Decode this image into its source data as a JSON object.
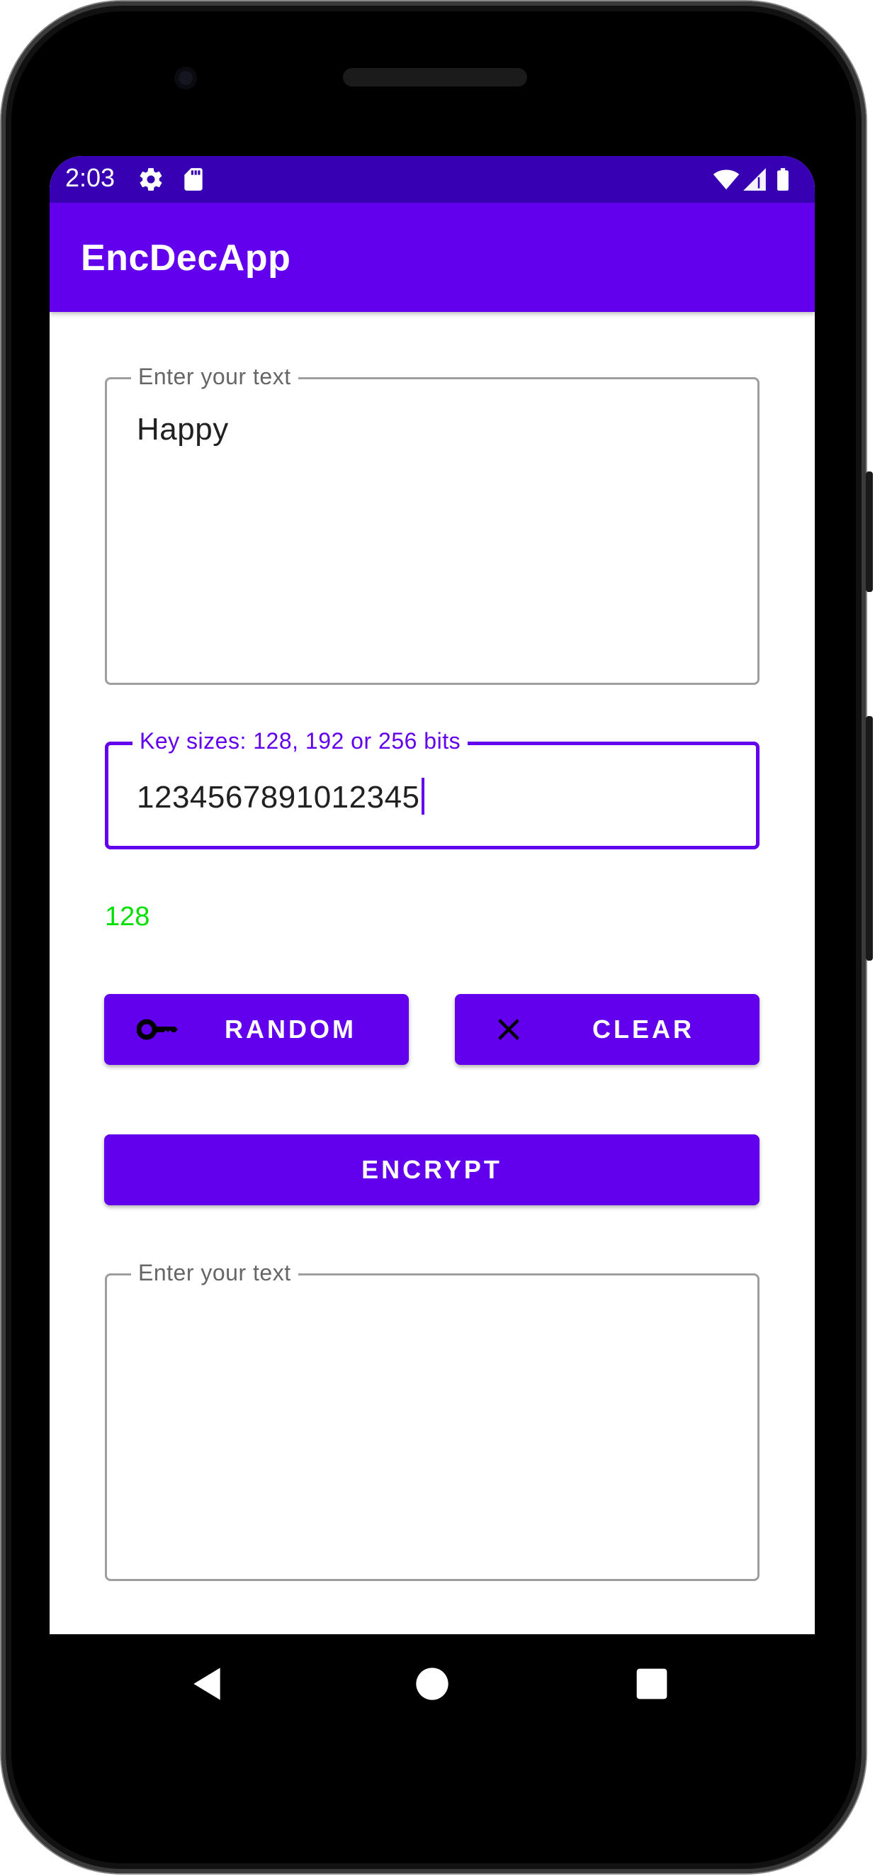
{
  "status_bar": {
    "time": "2:03",
    "icons": [
      "settings-icon",
      "sd-card-icon",
      "wifi-icon",
      "cellular-signal-icon",
      "battery-icon"
    ]
  },
  "app_bar": {
    "title": "EncDecApp"
  },
  "input_text": {
    "label": "Enter your text",
    "value": "Happy"
  },
  "key_field": {
    "label": "Key sizes: 128, 192 or 256 bits",
    "value": "1234567891012345"
  },
  "key_size_indicator": {
    "value": "128",
    "color": "#00e000"
  },
  "buttons": {
    "random": {
      "label": "RANDOM",
      "icon": "key-icon"
    },
    "clear": {
      "label": "CLEAR",
      "icon": "close-icon"
    },
    "encrypt": {
      "label": "ENCRYPT"
    }
  },
  "output_text": {
    "label": "Enter your text",
    "value": ""
  },
  "nav_bar": {
    "icons": [
      "back-icon",
      "home-icon",
      "recents-icon"
    ]
  },
  "colors": {
    "primary": "#6200ee",
    "primary_dark": "#3700b3",
    "key_size_text": "#00e000"
  }
}
